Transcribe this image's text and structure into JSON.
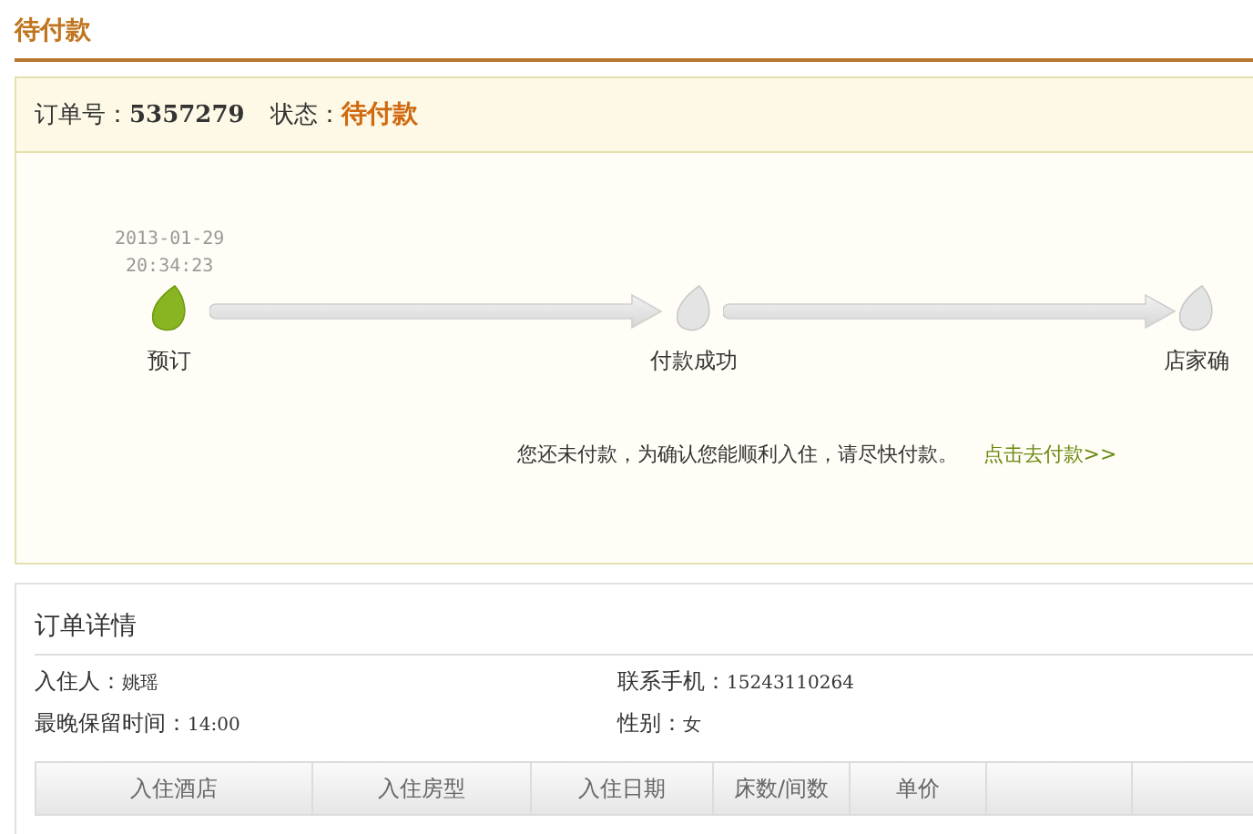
{
  "page_title": "待付款",
  "order": {
    "number_label": "订单号：",
    "number": "5357279",
    "status_label": "状态：",
    "status": "待付款"
  },
  "steps": [
    {
      "label": "预订",
      "date": "2013-01-29",
      "time": "20:34:23",
      "done": true
    },
    {
      "label": "付款成功",
      "done": false
    },
    {
      "label": "店家确",
      "done": false
    }
  ],
  "notice": {
    "text": "您还未付款，为确认您能顺利入住，请尽快付款。",
    "link": "点击去付款>>"
  },
  "details": {
    "title": "订单详情",
    "fields": [
      {
        "label": "入住人：",
        "value": "姚瑶"
      },
      {
        "label": "联系手机：",
        "value": "15243110264"
      },
      {
        "label": "最晚保留时间：",
        "value": "14:00"
      },
      {
        "label": "性别：",
        "value": "女"
      }
    ],
    "table": {
      "columns": [
        "入住酒店",
        "入住房型",
        "入住日期",
        "床数/间数",
        "单价",
        "",
        ""
      ]
    }
  }
}
